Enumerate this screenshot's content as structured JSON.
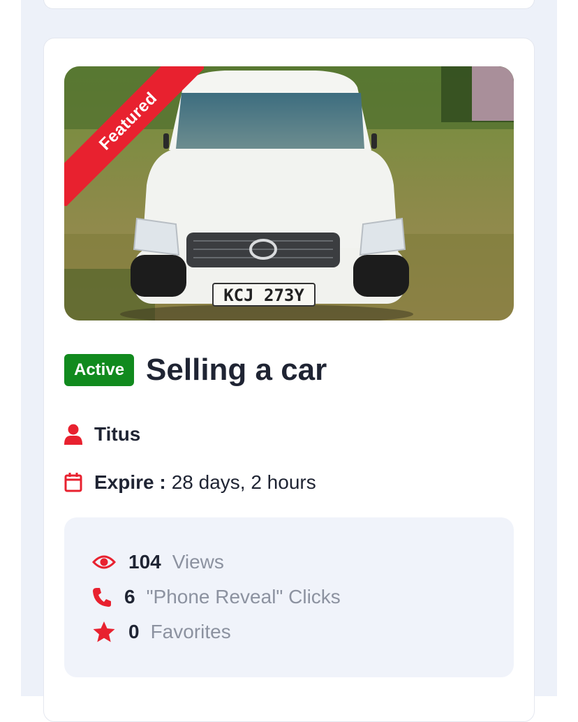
{
  "colors": {
    "accent": "#e8212f",
    "active": "#118a1e",
    "page_bg": "#edf1f9",
    "stats_bg": "#f0f3fa"
  },
  "listing": {
    "image_alt": "White Toyota Probox with plate KCJ 273Y",
    "plate": "KCJ 273Y",
    "ribbon": "Featured",
    "status": "Active",
    "title": "Selling a car",
    "seller": "Titus",
    "expire_label": "Expire :",
    "expire_value": "28 days, 2 hours"
  },
  "stats": [
    {
      "icon": "eye-icon",
      "value": "104",
      "label": "Views"
    },
    {
      "icon": "phone-icon",
      "value": "6",
      "label": "\"Phone Reveal\" Clicks"
    },
    {
      "icon": "star-icon",
      "value": "0",
      "label": "Favorites"
    }
  ]
}
